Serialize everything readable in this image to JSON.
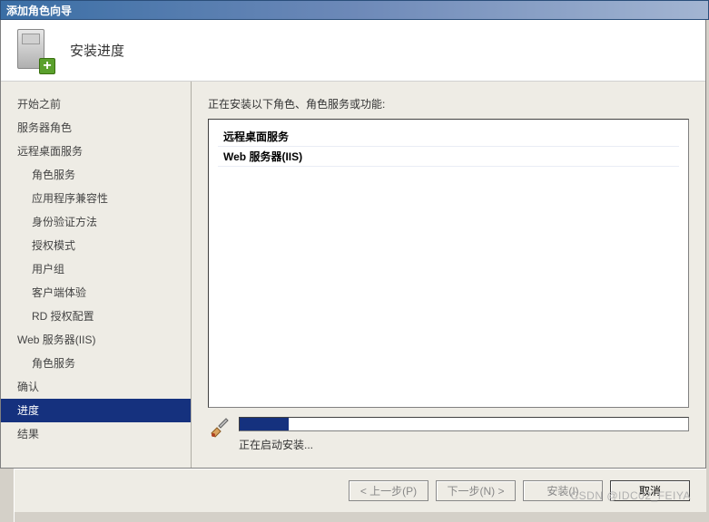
{
  "window": {
    "title": "添加角色向导"
  },
  "header": {
    "title": "安装进度"
  },
  "sidebar": {
    "items": [
      {
        "label": "开始之前",
        "sub": false
      },
      {
        "label": "服务器角色",
        "sub": false
      },
      {
        "label": "远程桌面服务",
        "sub": false
      },
      {
        "label": "角色服务",
        "sub": true
      },
      {
        "label": "应用程序兼容性",
        "sub": true
      },
      {
        "label": "身份验证方法",
        "sub": true
      },
      {
        "label": "授权模式",
        "sub": true
      },
      {
        "label": "用户组",
        "sub": true
      },
      {
        "label": "客户端体验",
        "sub": true
      },
      {
        "label": "RD 授权配置",
        "sub": true
      },
      {
        "label": "Web 服务器(IIS)",
        "sub": false
      },
      {
        "label": "角色服务",
        "sub": true
      },
      {
        "label": "确认",
        "sub": false
      },
      {
        "label": "进度",
        "sub": false,
        "active": true
      },
      {
        "label": "结果",
        "sub": false
      }
    ]
  },
  "main": {
    "description": "正在安装以下角色、角色服务或功能:",
    "items": [
      "远程桌面服务",
      "Web 服务器(IIS)"
    ],
    "progress_text": "正在启动安装..."
  },
  "buttons": {
    "prev": "< 上一步(P)",
    "next": "下一步(N) >",
    "install": "安装(I)",
    "cancel": "取消"
  },
  "watermark": "CSDN @IDC02_FEIYA"
}
